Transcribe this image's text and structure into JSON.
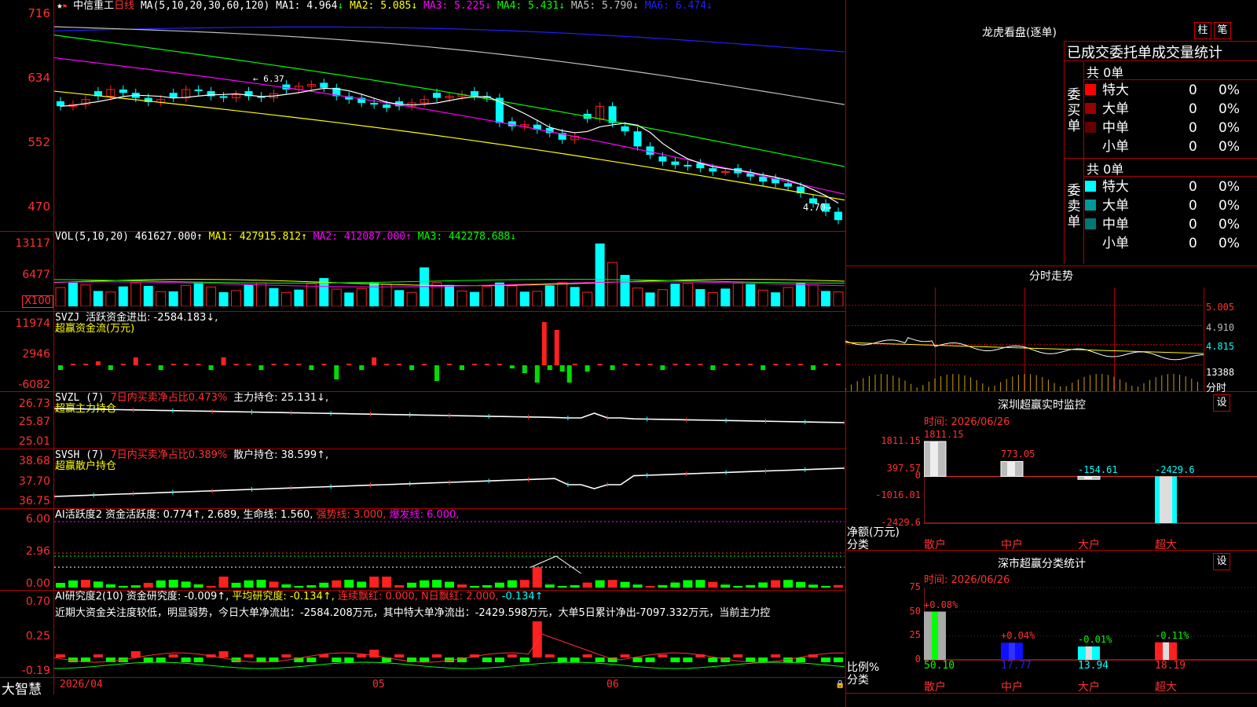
{
  "stock": {
    "name": "中信重工",
    "period": "日线"
  },
  "price_panel": {
    "ma_params": "MA(5,10,20,30,60,120)",
    "ma1_label": "MA1:",
    "ma1": "4.964",
    "ma1_arrow": "↓",
    "ma2": "MA2: 5.085↓",
    "ma3": "MA3: 5.225↓",
    "ma4": "MA4: 5.431↓",
    "ma5": "MA5: 5.790↓",
    "ma6": "MA6: 6.474↓",
    "axis": [
      "716",
      "634",
      "552",
      "470"
    ],
    "label_high": "← 6.37",
    "label_low": "4.70→",
    "colors": {
      "ma1": "#ffffff",
      "ma2": "#ffff00",
      "ma3": "#ff00ff",
      "ma4": "#00ff00",
      "ma5": "#c0c0c0",
      "ma6": "#2020ff",
      "up": "#ff2020",
      "down": "#00ffff"
    }
  },
  "vol_panel": {
    "params": "VOL(5,10,20)",
    "value": "461627.000↑",
    "ma1": "MA1: 427915.812↑",
    "ma2": "MA2: 412087.000↑",
    "ma3": "MA3: 442278.688↓",
    "axis": [
      "13117",
      "6477"
    ],
    "unit": "X100"
  },
  "svzj_panel": {
    "name": "SVZJ",
    "label": "活跃资金进出: -2584.183↓,",
    "sub": "超赢资金流(万元)",
    "axis": [
      "11974",
      "2946",
      "-6082"
    ]
  },
  "svzl_panel": {
    "name": "SVZL (7)",
    "pct": "7日内买卖净占比0.473%",
    "hold": "主力持仓: 25.131↓,",
    "sub": "超赢主力持仓",
    "axis": [
      "26.73",
      "25.87",
      "25.01"
    ]
  },
  "svsh_panel": {
    "name": "SVSH (7)",
    "pct": "7日内买卖净占比0.389%",
    "hold": "散户持仓: 38.599↑,",
    "sub": "超赢散户持仓",
    "axis": [
      "38.68",
      "37.70",
      "36.75"
    ]
  },
  "ai_active": {
    "name": "AI活跃度2",
    "v1": "资金活跃度: 0.774↑",
    "v2": ", 2.689,",
    "v3": "生命线: 1.560,",
    "v4": "强势线: 3.000,",
    "v5": "爆发线: 6.000,",
    "axis": [
      "6.00",
      "2.96",
      "0.00"
    ]
  },
  "ai_research": {
    "name": "AI研究度2(10)",
    "v1": "资金研究度: -0.009↑,",
    "v2": "平均研究度: -0.134↑,",
    "v3": "连续飘红: 0.000,",
    "v4": "N日飘红: 2.000,",
    "v5": "-0.134↑",
    "comment": "近期大资金关注度较低，明显弱势，今日大单净流出：-2584.208万元，其中特大单净流出：-2429.598万元，大单5日累计净出-7097.332万元，当前主力控",
    "axis": [
      "0.70",
      "0.25",
      "-0.19"
    ]
  },
  "date_axis": [
    "2026/04",
    "05",
    "06"
  ],
  "brand": "大智慧",
  "lhb": {
    "title": "龙虎看盘(逐单)",
    "btn_zhu": "柱",
    "btn_bi": "笔",
    "header": "已成交委托单成交量统计",
    "buy_label": "委买单",
    "sell_label": "委卖单",
    "buy_total": "共 0单",
    "sell_total": "共 0单",
    "buy_rows": [
      {
        "n": "特大",
        "v": "0",
        "p": "0%",
        "c": "#ff0000"
      },
      {
        "n": "大单",
        "v": "0",
        "p": "0%",
        "c": "#990000"
      },
      {
        "n": "中单",
        "v": "0",
        "p": "0%",
        "c": "#660000"
      },
      {
        "n": "小单",
        "v": "0",
        "p": "0%",
        "c": ""
      }
    ],
    "sell_rows": [
      {
        "n": "特大",
        "v": "0",
        "p": "0%",
        "c": "#00ffff"
      },
      {
        "n": "大单",
        "v": "0",
        "p": "0%",
        "c": "#009999"
      },
      {
        "n": "中单",
        "v": "0",
        "p": "0%",
        "c": "#007777"
      },
      {
        "n": "小单",
        "v": "0",
        "p": "0%",
        "c": ""
      }
    ]
  },
  "intraday": {
    "title": "分时走势",
    "axis": [
      "5.005",
      "4.910",
      "4.815",
      "13388"
    ],
    "bottom": "分时"
  },
  "monitor": {
    "title": "深圳超赢实时监控",
    "btn": "设",
    "time": "时间: 2026/06/26",
    "axis": [
      "1811.15",
      "397.57",
      "0",
      "-1016.01",
      "-2429.6"
    ],
    "vals": [
      "1811.15",
      "773.05",
      "-154.61",
      "-2429.6"
    ],
    "cats": [
      "散户",
      "中户",
      "大户",
      "超大"
    ],
    "ylabel": "净额(万元)",
    "xlabel": "分类"
  },
  "classify": {
    "title": "深市超赢分类统计",
    "btn": "设",
    "time": "时间: 2026/06/26",
    "axis": [
      "75",
      "50",
      "25",
      "0"
    ],
    "pcts": [
      "+0.08%",
      "+0.04%",
      "-0.01%",
      "-0.11%"
    ],
    "vals": [
      "50.10",
      "17.77",
      "13.94",
      "18.19"
    ],
    "cats": [
      "散户",
      "中户",
      "大户",
      "超大"
    ],
    "ylabel": "比例%",
    "xlabel": "分类"
  },
  "chart_data": {
    "type": "bar",
    "categories": [
      "散户",
      "中户",
      "大户",
      "超大"
    ],
    "series": [
      {
        "name": "净额(万元)",
        "values": [
          1811.15,
          773.05,
          -154.61,
          -2429.6
        ]
      },
      {
        "name": "比例%",
        "values": [
          50.1,
          17.77,
          13.94,
          18.19
        ]
      }
    ]
  }
}
